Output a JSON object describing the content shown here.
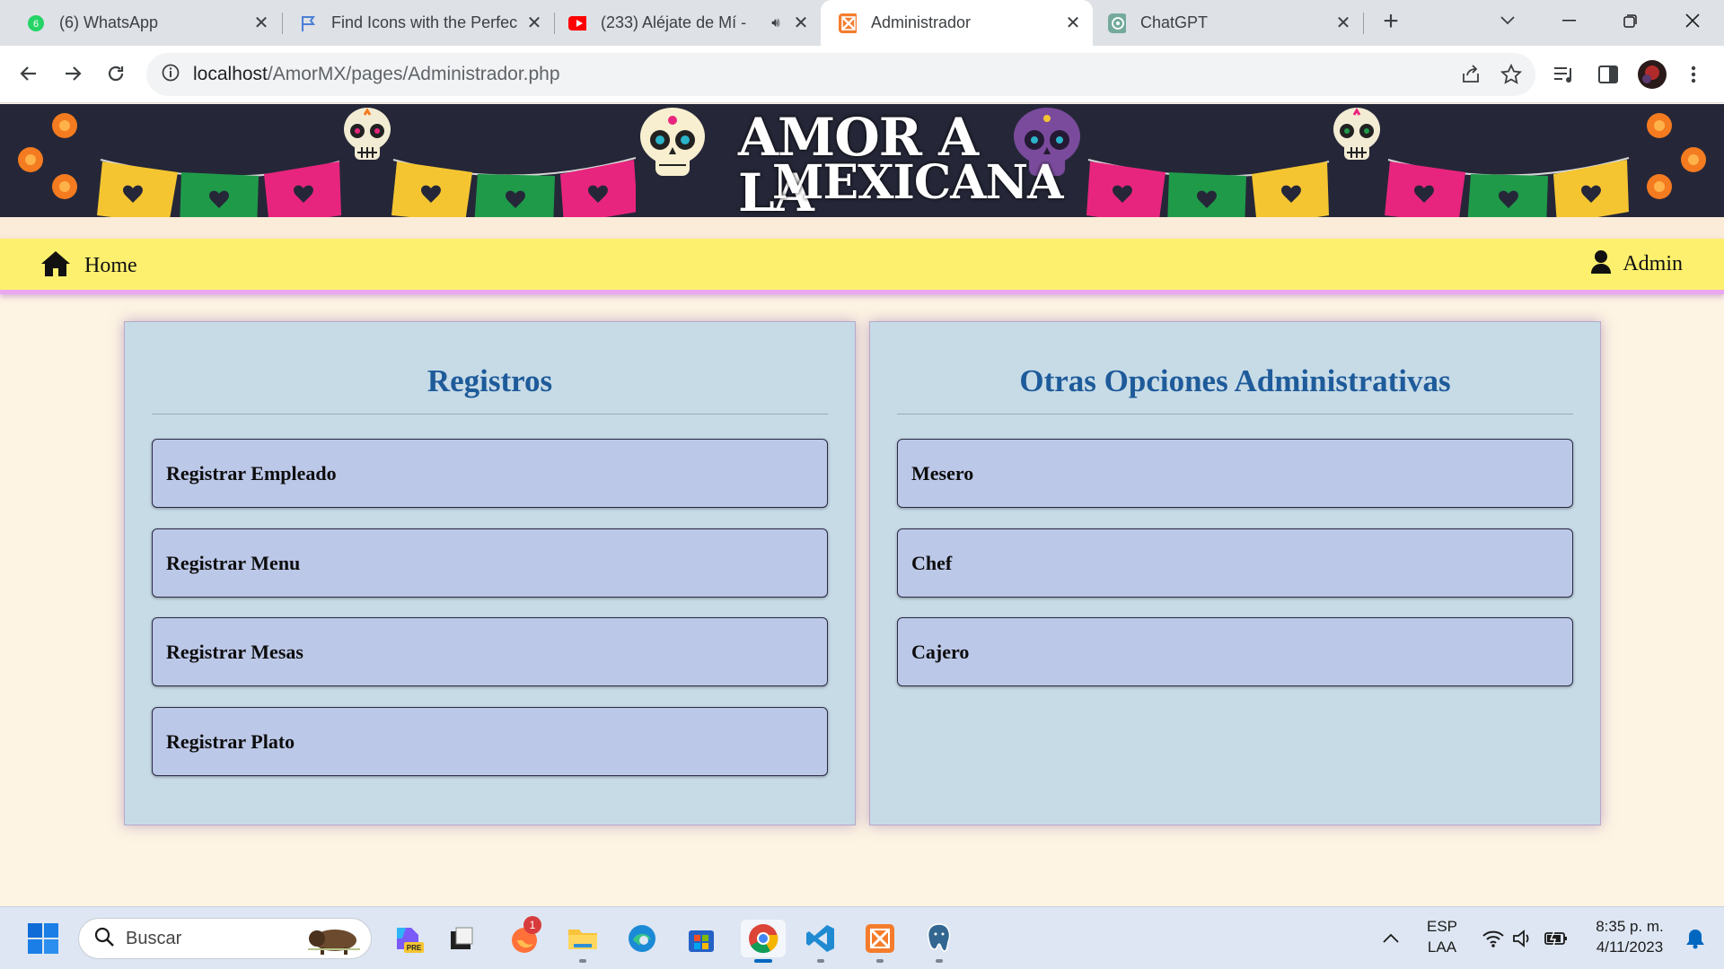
{
  "browser": {
    "tabs": [
      {
        "label": "(6) WhatsApp",
        "icon": "whatsapp-icon",
        "active": false
      },
      {
        "label": "Find Icons with the Perfec",
        "icon": "flag-icon",
        "active": false
      },
      {
        "label": "(233) Aléjate de Mí -",
        "icon": "youtube-icon",
        "active": false
      },
      {
        "label": "Administrador",
        "icon": "xampp-icon",
        "active": true
      },
      {
        "label": "ChatGPT",
        "icon": "chatgpt-icon",
        "active": false
      }
    ],
    "url_host": "localhost",
    "url_path": "/AmorMX/pages/Administrador.php"
  },
  "banner": {
    "logo_line1": "AMOR A LA",
    "logo_line2": "MEXICANA"
  },
  "navbar": {
    "home_label": "Home",
    "admin_label": "Admin"
  },
  "panels": {
    "registros": {
      "title": "Registros",
      "items": [
        "Registrar Empleado",
        "Registrar Menu",
        "Registrar Mesas",
        "Registrar Plato"
      ]
    },
    "otras": {
      "title": "Otras Opciones Administrativas",
      "items": [
        "Mesero",
        "Chef",
        "Cajero"
      ]
    }
  },
  "taskbar": {
    "search_placeholder": "Buscar",
    "language": "ESP",
    "layout": "LAA",
    "time": "8:35 p. m.",
    "date": "4/11/2023",
    "badge_count": "1"
  },
  "colors": {
    "page_bg": "#fdf4e3",
    "navbar_bg": "#fdf06e",
    "panel_bg": "#c7dbe7",
    "button_bg": "#bcc8e8",
    "title_color": "#1e5b9a",
    "banner_bg": "#252738"
  }
}
